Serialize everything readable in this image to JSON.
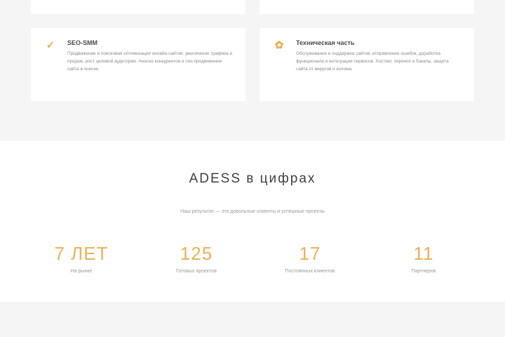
{
  "services": {
    "cards": [
      {
        "icon": "chart-check-icon",
        "icon_glyph": "✓",
        "title": "SEO-SMM",
        "text": "Продвижение и поисковая оптимизация онлайн-сайтов: увеличение трафика и продаж, рост целевой аудитории. Анализ конкурентов и сео-продвижение сайта в поиске."
      },
      {
        "icon": "tools-icon",
        "icon_glyph": "✿",
        "title": "Техническая часть",
        "text": "Обслуживание и поддержка сайтов, исправление ошибок, доработка функционала и интеграция сервисов. Хостинг, перенос и бэкапы, защита сайта от вирусов и взлома."
      }
    ]
  },
  "stats": {
    "title": "ADESS в цифрах",
    "subtitle": "Наш результат — это довольные клиенты и успешные проекты",
    "items": [
      {
        "value": "7 ЛЕТ",
        "label": "На рынке"
      },
      {
        "value": "125",
        "label": "Готовых проектов"
      },
      {
        "value": "17",
        "label": "Постоянных клиентов"
      },
      {
        "value": "11",
        "label": "Партнеров"
      }
    ]
  },
  "colors": {
    "accent": "#e9b25a",
    "background": "#f4f5f4",
    "card": "#ffffff"
  }
}
